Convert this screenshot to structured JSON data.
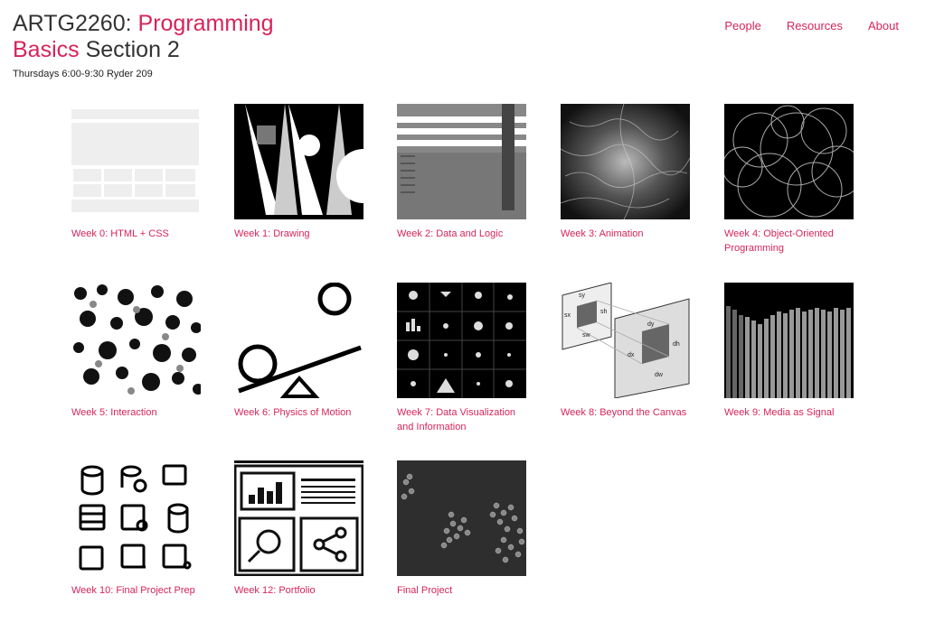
{
  "header": {
    "code": "ARTG2260: ",
    "title_part1": "Programming",
    "title_part2": "Basics",
    "title_part3": " Section 2",
    "schedule": "Thursdays 6:00-9:30 Ryder 209"
  },
  "nav": {
    "people": "People",
    "resources": "Resources",
    "about": "About"
  },
  "colors": {
    "accent": "#d6245a",
    "text": "#333333"
  },
  "weeks": [
    {
      "label": "Week 0: HTML + CSS",
      "icon": "html-css-wireframe-icon"
    },
    {
      "label": "Week 1: Drawing",
      "icon": "drawing-shapes-icon"
    },
    {
      "label": "Week 2: Data and Logic",
      "icon": "data-logic-icon"
    },
    {
      "label": "Week 3: Animation",
      "icon": "animation-texture-icon"
    },
    {
      "label": "Week 4: Object-Oriented Programming",
      "icon": "circles-icon"
    },
    {
      "label": "Week 5: Interaction",
      "icon": "interaction-noise-icon"
    },
    {
      "label": "Week 6: Physics of Motion",
      "icon": "seesaw-icon"
    },
    {
      "label": "Week 7: Data Visualization and Information",
      "icon": "data-viz-grid-icon"
    },
    {
      "label": "Week 8: Beyond the Canvas",
      "icon": "canvas-diagram-icon"
    },
    {
      "label": "Week 9: Media as Signal",
      "icon": "signal-bars-icon"
    },
    {
      "label": "Week 10: Final Project Prep",
      "icon": "database-icons-icon"
    },
    {
      "label": "Week 12: Portfolio",
      "icon": "portfolio-layout-icon"
    },
    {
      "label": "Final Project",
      "icon": "dots-cluster-icon"
    }
  ],
  "week8_diagram": [
    "sy",
    "sx",
    "sh",
    "sw",
    "dy",
    "dx",
    "dh",
    "dw"
  ]
}
